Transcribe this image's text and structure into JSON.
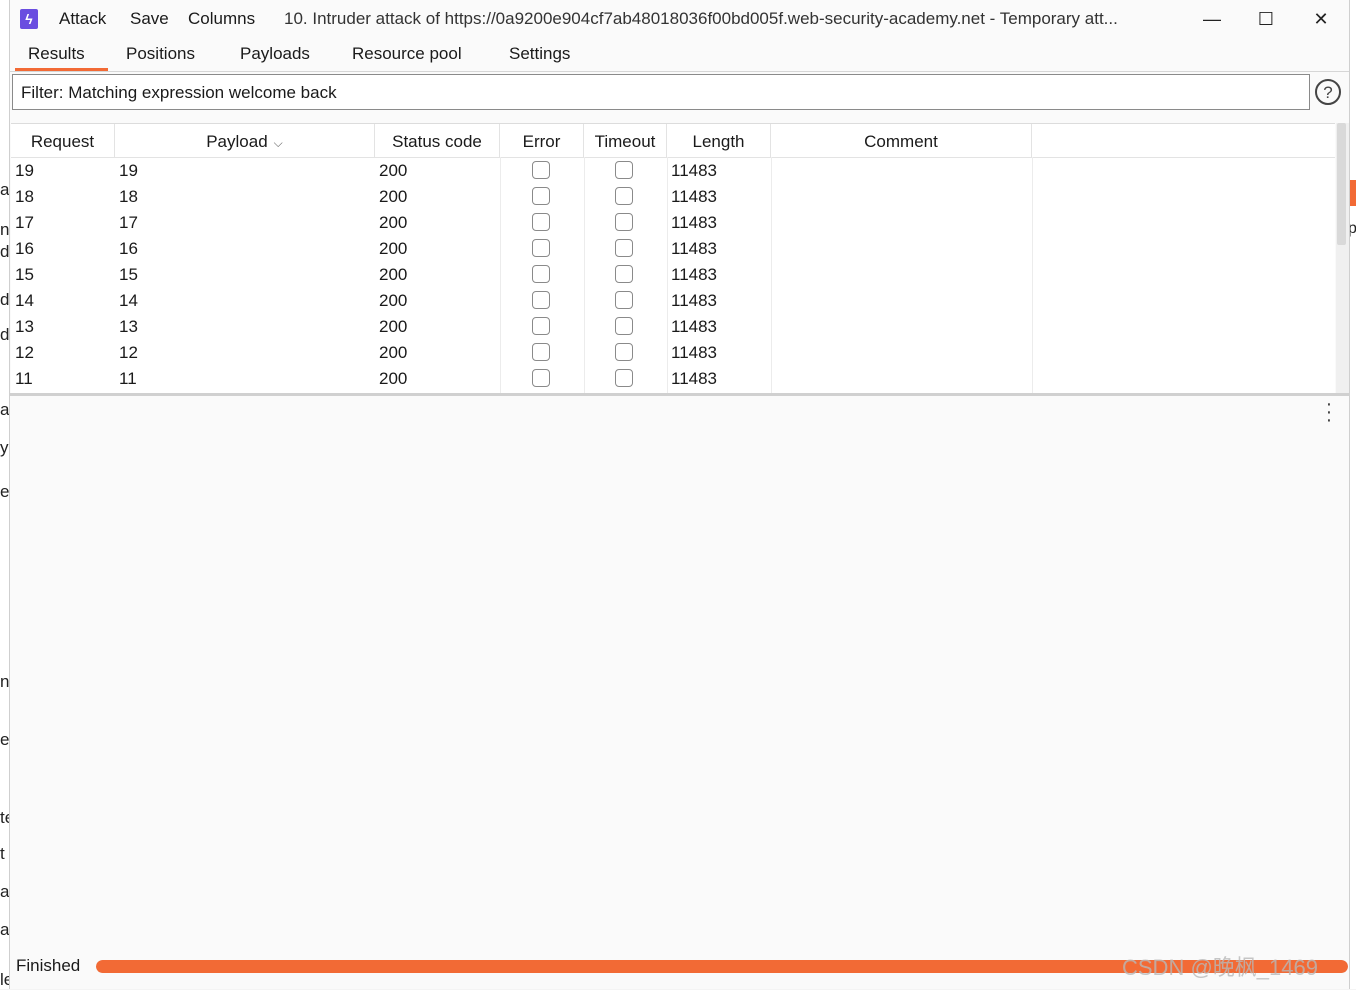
{
  "window": {
    "menu": [
      "Attack",
      "Save",
      "Columns"
    ],
    "title": "10. Intruder attack of https://0a9200e904cf7ab48018036f00bd005f.web-security-academy.net - Temporary att...",
    "controls": {
      "minimize": "—",
      "maximize": "☐",
      "close": "✕"
    }
  },
  "tabs": [
    "Results",
    "Positions",
    "Payloads",
    "Resource pool",
    "Settings"
  ],
  "active_tab": "Results",
  "filter": {
    "text": "Filter: Matching expression welcome back",
    "help": "?"
  },
  "table": {
    "columns": [
      "Request",
      "Payload",
      "Status code",
      "Error",
      "Timeout",
      "Length",
      "Comment"
    ],
    "sort_indicator": "⌵",
    "rows": [
      {
        "request": "19",
        "payload": "19",
        "status": "200",
        "error": false,
        "timeout": false,
        "length": "11483",
        "comment": ""
      },
      {
        "request": "18",
        "payload": "18",
        "status": "200",
        "error": false,
        "timeout": false,
        "length": "11483",
        "comment": ""
      },
      {
        "request": "17",
        "payload": "17",
        "status": "200",
        "error": false,
        "timeout": false,
        "length": "11483",
        "comment": ""
      },
      {
        "request": "16",
        "payload": "16",
        "status": "200",
        "error": false,
        "timeout": false,
        "length": "11483",
        "comment": ""
      },
      {
        "request": "15",
        "payload": "15",
        "status": "200",
        "error": false,
        "timeout": false,
        "length": "11483",
        "comment": ""
      },
      {
        "request": "14",
        "payload": "14",
        "status": "200",
        "error": false,
        "timeout": false,
        "length": "11483",
        "comment": ""
      },
      {
        "request": "13",
        "payload": "13",
        "status": "200",
        "error": false,
        "timeout": false,
        "length": "11483",
        "comment": ""
      },
      {
        "request": "12",
        "payload": "12",
        "status": "200",
        "error": false,
        "timeout": false,
        "length": "11483",
        "comment": ""
      },
      {
        "request": "11",
        "payload": "11",
        "status": "200",
        "error": false,
        "timeout": false,
        "length": "11483",
        "comment": ""
      }
    ]
  },
  "status": {
    "text": "Finished",
    "progress": 1.0
  },
  "watermark": "CSDN @晚枫_1469",
  "background_fragments": {
    "left": [
      "a",
      "n",
      "d",
      "d",
      "d",
      "a",
      "y",
      "e",
      "na",
      "e",
      "te",
      "t",
      "ac",
      "a",
      "les"
    ],
    "right": "p"
  },
  "colors": {
    "accent": "#f26a35",
    "app_icon": "#6a4de0"
  }
}
